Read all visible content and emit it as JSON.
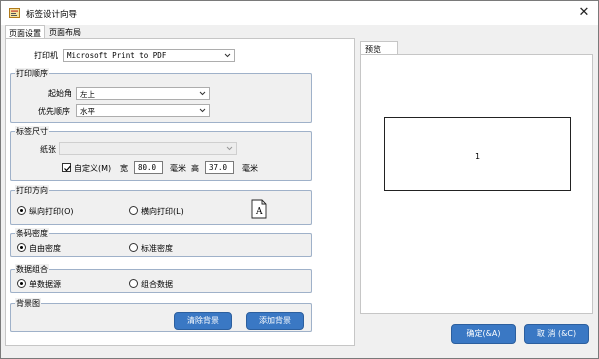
{
  "window": {
    "title": "标签设计向导",
    "close_glyph": "✕"
  },
  "tabs": [
    {
      "label": "页面设置",
      "active": true
    },
    {
      "label": "页面布局",
      "active": false
    }
  ],
  "printer": {
    "label": "打印机",
    "value": "Microsoft Print to PDF"
  },
  "print_order": {
    "title": "打印顺序",
    "start_corner": {
      "label": "起始角",
      "value": "左上"
    },
    "priority": {
      "label": "优先顺序",
      "value": "水平"
    }
  },
  "label_size": {
    "title": "标签尺寸",
    "paper": {
      "label": "纸张",
      "value": ""
    },
    "custom": {
      "label": "自定义(M)",
      "checked": true
    },
    "width": {
      "label": "宽",
      "value": "80.0",
      "unit": "毫米"
    },
    "height": {
      "label": "高",
      "value": "37.0",
      "unit": "毫米"
    }
  },
  "orientation": {
    "title": "打印方向",
    "portrait": {
      "label": "纵向打印(O)",
      "selected": true
    },
    "landscape": {
      "label": "横向打印(L)",
      "selected": false
    },
    "icon_letter": "A"
  },
  "barcode_density": {
    "title": "条码密度",
    "custom": {
      "label": "自由密度",
      "selected": true
    },
    "standard": {
      "label": "标准密度",
      "selected": false
    }
  },
  "data_combine": {
    "title": "数据组合",
    "single": {
      "label": "单数据源",
      "selected": true
    },
    "combined": {
      "label": "组合数据",
      "selected": false
    }
  },
  "background": {
    "title": "背景图",
    "clear_label": "清除背景",
    "add_label": "添加背景"
  },
  "preview": {
    "tab_label": "预览",
    "label_number": "1"
  },
  "footer": {
    "ok_label": "确定(&A)",
    "cancel_label": "取 消 (&C)"
  },
  "colors": {
    "button": "#3a78c4",
    "group_border": "#9fb1c9"
  }
}
